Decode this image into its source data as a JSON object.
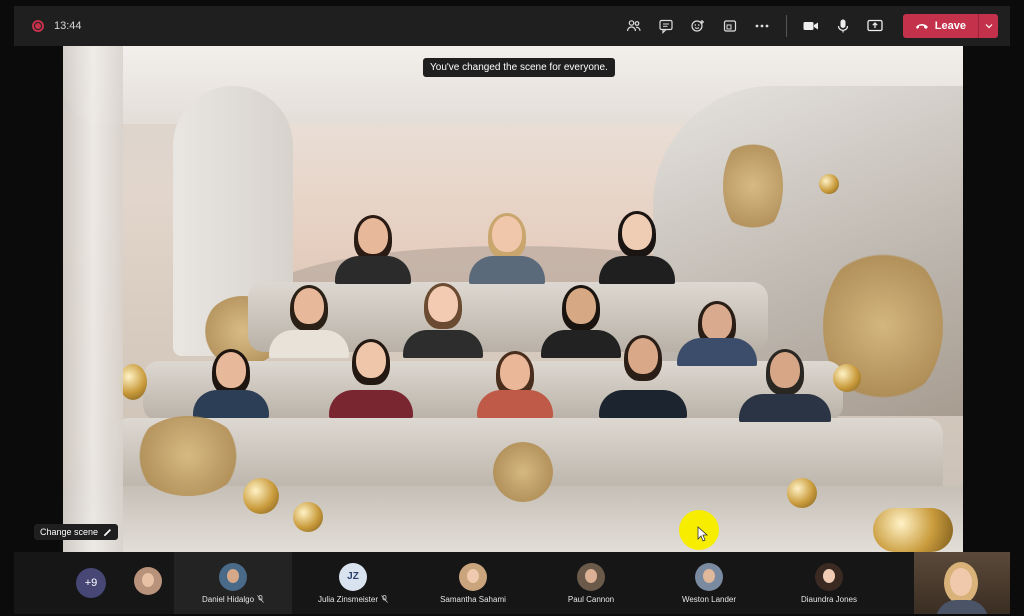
{
  "header": {
    "recording_icon": "recording-dot-icon",
    "time": "13:44",
    "toolbar_icons": [
      "people-icon",
      "chat-icon",
      "reactions-icon",
      "share-tray-icon",
      "more-icon",
      "camera-icon",
      "microphone-icon",
      "share-screen-icon"
    ],
    "leave_label": "Leave",
    "accent_color": "#c4314b"
  },
  "scene": {
    "toast": "You've changed the scene for everyone.",
    "change_scene_label": "Change scene"
  },
  "strip": {
    "overflow_count": "+9",
    "participants": [
      {
        "name": "",
        "kind": "avatar"
      },
      {
        "name": "Daniel Hidalgo",
        "kind": "avatar",
        "muted": true
      },
      {
        "name": "Julia Zinsmeister",
        "kind": "initials",
        "initials": "JZ",
        "muted": true
      },
      {
        "name": "Samantha Sahami",
        "kind": "avatar"
      },
      {
        "name": "Paul Cannon",
        "kind": "avatar"
      },
      {
        "name": "Weston Lander",
        "kind": "avatar"
      },
      {
        "name": "Diaundra Jones",
        "kind": "avatar"
      }
    ]
  }
}
